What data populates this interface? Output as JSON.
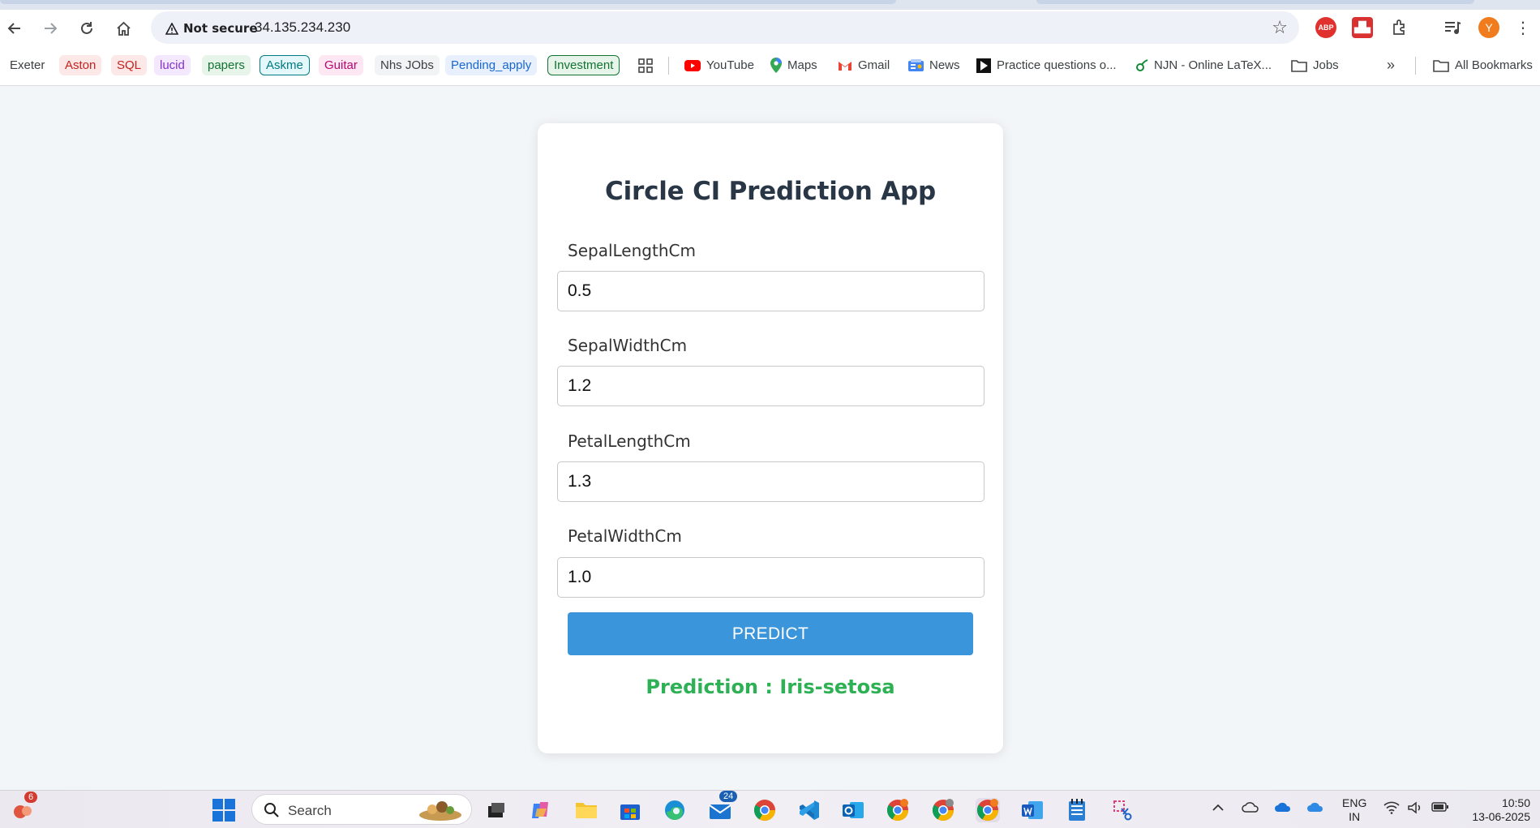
{
  "browser": {
    "security_label": "Not secure",
    "url": "34.135.234.230",
    "avatar_initial": "Y",
    "abp_label": "ABP"
  },
  "bookmarks": [
    {
      "label": "Exeter",
      "color": "#3c4043",
      "bg": "transparent",
      "border": "none"
    },
    {
      "label": "Aston",
      "color": "#c5221f",
      "bg": "#fce8e6",
      "border": "none"
    },
    {
      "label": "SQL",
      "color": "#c5221f",
      "bg": "#fce8e6",
      "border": "none"
    },
    {
      "label": "lucid",
      "color": "#8430ce",
      "bg": "#f3e8fd",
      "border": "none"
    },
    {
      "label": "papers",
      "color": "#137333",
      "bg": "#e6f4ea",
      "border": "none"
    },
    {
      "label": "Askme",
      "color": "#007b83",
      "bg": "#e4f7fb",
      "border": "1px solid #007b83"
    },
    {
      "label": "Guitar",
      "color": "#b80672",
      "bg": "#fde7f3",
      "border": "none"
    },
    {
      "label": "Nhs JObs",
      "color": "#3c4043",
      "bg": "#f1f3f4",
      "border": "none"
    },
    {
      "label": "Pending_apply",
      "color": "#1967d2",
      "bg": "#e8f0fe",
      "border": "none"
    },
    {
      "label": "Investment",
      "color": "#137333",
      "bg": "#e6f4ea",
      "border": "1px solid #137333"
    },
    {
      "label": "YouTube",
      "color": "#3c4043",
      "bg": "transparent",
      "border": "none",
      "icon": "youtube-icon"
    },
    {
      "label": "Maps",
      "color": "#3c4043",
      "bg": "transparent",
      "border": "none",
      "icon": "maps-icon"
    },
    {
      "label": "Gmail",
      "color": "#3c4043",
      "bg": "transparent",
      "border": "none",
      "icon": "gmail-icon"
    },
    {
      "label": "News",
      "color": "#3c4043",
      "bg": "transparent",
      "border": "none",
      "icon": "news-icon"
    },
    {
      "label": "Practice questions o...",
      "color": "#3c4043",
      "bg": "transparent",
      "border": "none",
      "icon": "practice-icon"
    },
    {
      "label": "NJN - Online LaTeX...",
      "color": "#3c4043",
      "bg": "transparent",
      "border": "none",
      "icon": "overleaf-icon"
    },
    {
      "label": "Jobs",
      "color": "#3c4043",
      "bg": "transparent",
      "border": "none",
      "icon": "folder-icon"
    },
    {
      "label": "All Bookmarks",
      "color": "#3c4043",
      "bg": "transparent",
      "border": "none",
      "icon": "folder-icon"
    }
  ],
  "app": {
    "title": "Circle CI Prediction App",
    "fields": [
      {
        "label": "SepalLengthCm",
        "value": "0.5"
      },
      {
        "label": "SepalWidthCm",
        "value": "1.2"
      },
      {
        "label": "PetalLengthCm",
        "value": "1.3"
      },
      {
        "label": "PetalWidthCm",
        "value": "1.0"
      }
    ],
    "button_label": "PREDICT",
    "result": "Prediction : Iris-setosa",
    "accent_color": "#3b95da",
    "result_color": "#2db154"
  },
  "taskbar": {
    "search_label": "Search",
    "widgets_badge": "6",
    "mail_badge": "24",
    "lang_top": "ENG",
    "lang_bottom": "IN",
    "time": "10:50",
    "date": "13-06-2025"
  }
}
